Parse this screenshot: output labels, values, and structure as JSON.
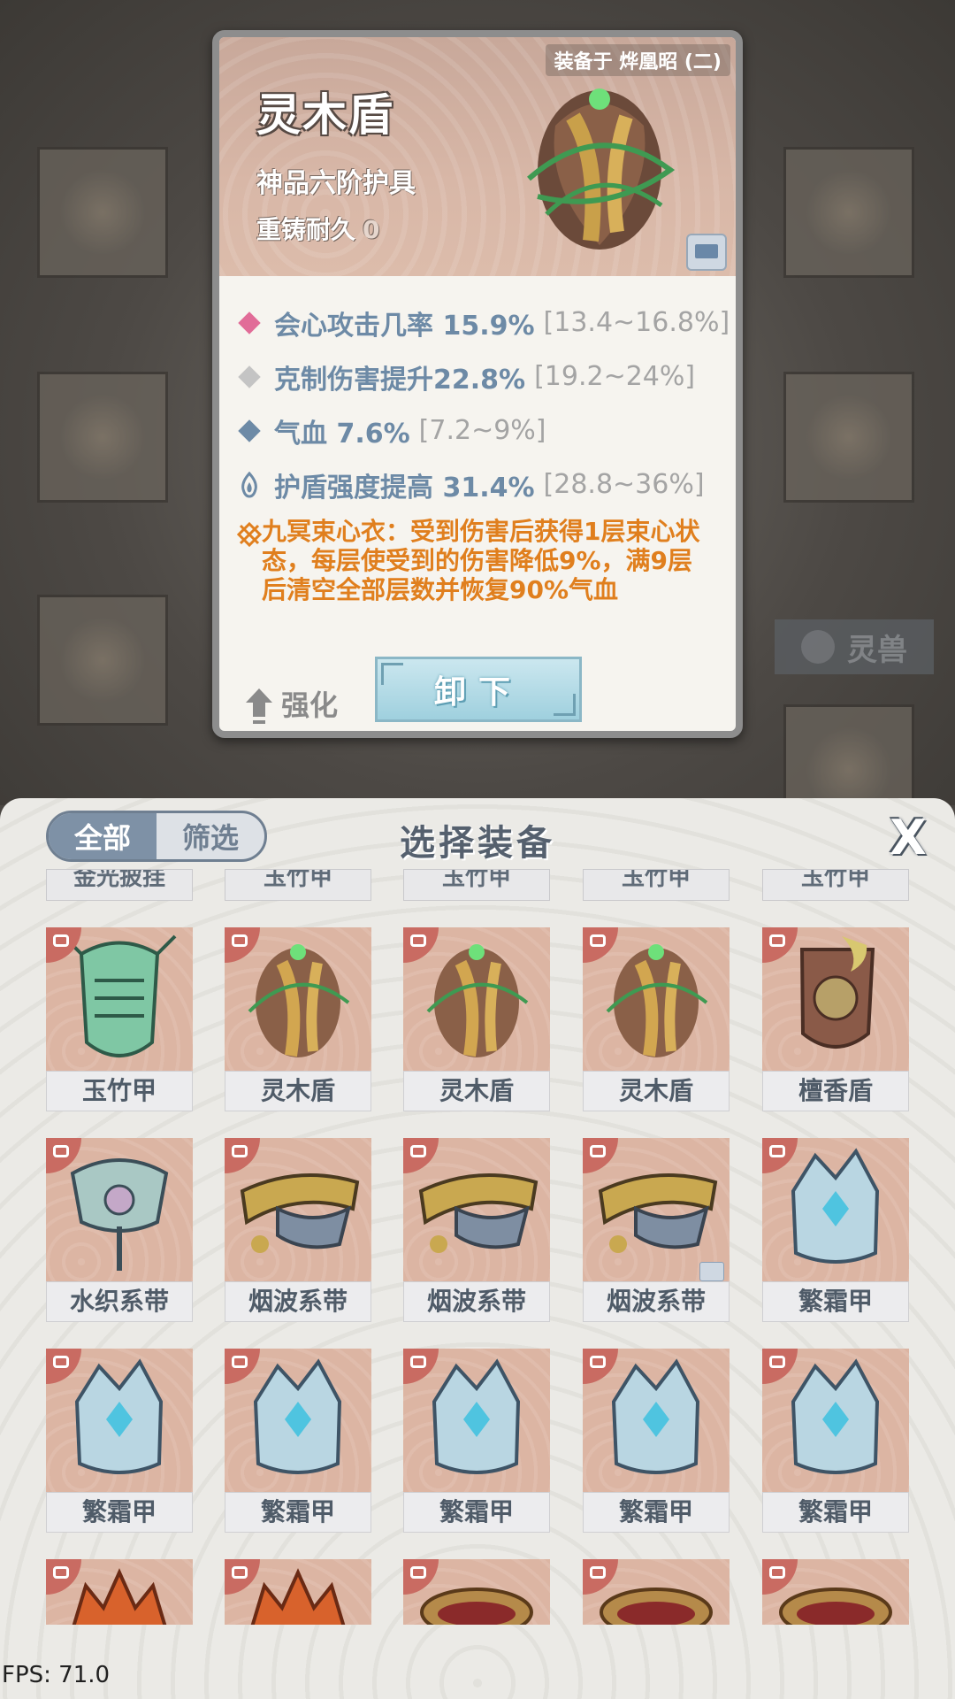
{
  "detail_card": {
    "equipped_to": "装备于 烨凰昭 (二)",
    "name": "灵木盾",
    "grade": "神品六阶护具",
    "durability_label": "重铸耐久",
    "durability_value": "0",
    "stats": [
      {
        "icon": "pink-diamond-icon",
        "color": "#e16c98",
        "text": "会心攻击几率 15.9%",
        "range": "[13.4~16.8%]"
      },
      {
        "icon": "grey-diamond-icon",
        "color": "#c4c4c4",
        "text": "克制伤害提升22.8%",
        "range": "[19.2~24%]"
      },
      {
        "icon": "blue-diamond-icon",
        "color": "#6d8aa6",
        "text": "气血 7.6%",
        "range": "[7.2~9%]"
      },
      {
        "icon": "shield-flame-icon",
        "color": "#6d8aa6",
        "text": "护盾强度提高 31.4%",
        "range": "[28.8~36%]"
      }
    ],
    "special_effect": "九冥束心衣：受到伤害后获得1层束心状态，每层使受到的伤害降低9%，满9层后清空全部层数并恢复90%气血",
    "upgrade_label": "强化",
    "unequip_label": "卸下"
  },
  "panel": {
    "title": "选择装备",
    "tabs": [
      {
        "label": "全部",
        "active": true
      },
      {
        "label": "筛选",
        "active": false
      }
    ],
    "close_label": "X"
  },
  "grid": {
    "partial_top": [
      "金光披挂",
      "玉竹甲",
      "玉竹甲",
      "玉竹甲",
      "玉竹甲"
    ],
    "rows": [
      [
        {
          "name": "玉竹甲",
          "icon": "jade-bamboo-armor-icon"
        },
        {
          "name": "灵木盾",
          "icon": "spirit-wood-shield-icon"
        },
        {
          "name": "灵木盾",
          "icon": "spirit-wood-shield-icon"
        },
        {
          "name": "灵木盾",
          "icon": "spirit-wood-shield-icon"
        },
        {
          "name": "檀香盾",
          "icon": "sandalwood-shield-icon"
        }
      ],
      [
        {
          "name": "水织系带",
          "icon": "water-weave-belt-icon"
        },
        {
          "name": "烟波系带",
          "icon": "mist-wave-belt-icon"
        },
        {
          "name": "烟波系带",
          "icon": "mist-wave-belt-icon"
        },
        {
          "name": "烟波系带",
          "icon": "mist-wave-belt-icon",
          "locked": true
        },
        {
          "name": "繁霜甲",
          "icon": "frost-armor-icon"
        }
      ],
      [
        {
          "name": "繁霜甲",
          "icon": "frost-armor-icon"
        },
        {
          "name": "繁霜甲",
          "icon": "frost-armor-icon"
        },
        {
          "name": "繁霜甲",
          "icon": "frost-armor-icon"
        },
        {
          "name": "繁霜甲",
          "icon": "frost-armor-icon"
        },
        {
          "name": "繁霜甲",
          "icon": "frost-armor-icon"
        }
      ]
    ],
    "partial_bottom": [
      {
        "icon": "flame-crown-icon"
      },
      {
        "icon": "flame-crown-icon"
      },
      {
        "icon": "bronze-bowl-icon"
      },
      {
        "icon": "bronze-bowl-icon"
      },
      {
        "icon": "bronze-bowl-icon"
      }
    ]
  },
  "background": {
    "tag_label": "灵兽"
  },
  "debug": {
    "fps": "FPS: 71.0"
  }
}
